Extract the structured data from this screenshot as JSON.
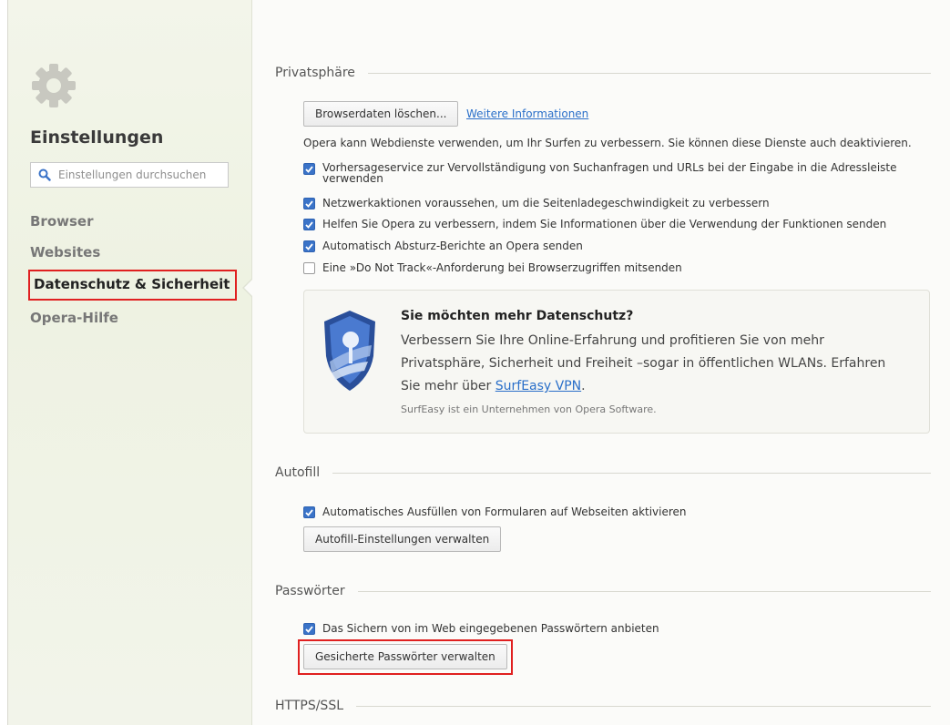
{
  "sidebar": {
    "title": "Einstellungen",
    "search_placeholder": "Einstellungen durchsuchen",
    "items": [
      {
        "label": "Browser"
      },
      {
        "label": "Websites"
      },
      {
        "label": "Datenschutz & Sicherheit",
        "active": true
      },
      {
        "label": "Opera-Hilfe"
      }
    ]
  },
  "privacy": {
    "heading": "Privatsphäre",
    "clear_button": "Browserdaten löschen...",
    "more_info_link": "Weitere Informationen",
    "intro": "Opera kann Webdienste verwenden, um Ihr Surfen zu verbessern. Sie können diese Dienste auch deaktivieren.",
    "options": [
      {
        "label": "Vorhersageservice zur Vervollständigung von Suchanfragen und URLs bei der Eingabe in die Adressleiste",
        "label_cont": "verwenden",
        "checked": true
      },
      {
        "label": "Netzwerkaktionen voraussehen, um die Seitenladegeschwindigkeit zu verbessern",
        "checked": true
      },
      {
        "label": "Helfen Sie Opera zu verbessern, indem Sie Informationen über die Verwendung der Funktionen senden",
        "checked": true
      },
      {
        "label": "Automatisch Absturz-Berichte an Opera senden",
        "checked": true
      },
      {
        "label": "Eine »Do Not Track«-Anforderung bei Browserzugriffen mitsenden",
        "checked": false
      }
    ]
  },
  "promo": {
    "title": "Sie möchten mehr Datenschutz?",
    "line1": "Verbessern Sie Ihre Online-Erfahrung und profitieren Sie von mehr",
    "line2": "Privatsphäre, Sicherheit und Freiheit –sogar in öffentlichen WLANs. Erfahren",
    "line3_prefix": "Sie mehr über ",
    "line3_link": "SurfEasy VPN",
    "line3_suffix": ".",
    "footnote": "SurfEasy ist ein Unternehmen von Opera Software."
  },
  "autofill": {
    "heading": "Autofill",
    "option": "Automatisches Ausfüllen von Formularen auf Webseiten aktivieren",
    "checked": true,
    "button": "Autofill-Einstellungen verwalten"
  },
  "passwords": {
    "heading": "Passwörter",
    "option": "Das Sichern von im Web eingegebenen Passwörtern anbieten",
    "checked": true,
    "button": "Gesicherte Passwörter verwalten"
  },
  "https": {
    "heading": "HTTPS/SSL"
  },
  "colors": {
    "accent": "#3a73c8",
    "highlight": "#e02020",
    "link": "#2a6fc9"
  }
}
